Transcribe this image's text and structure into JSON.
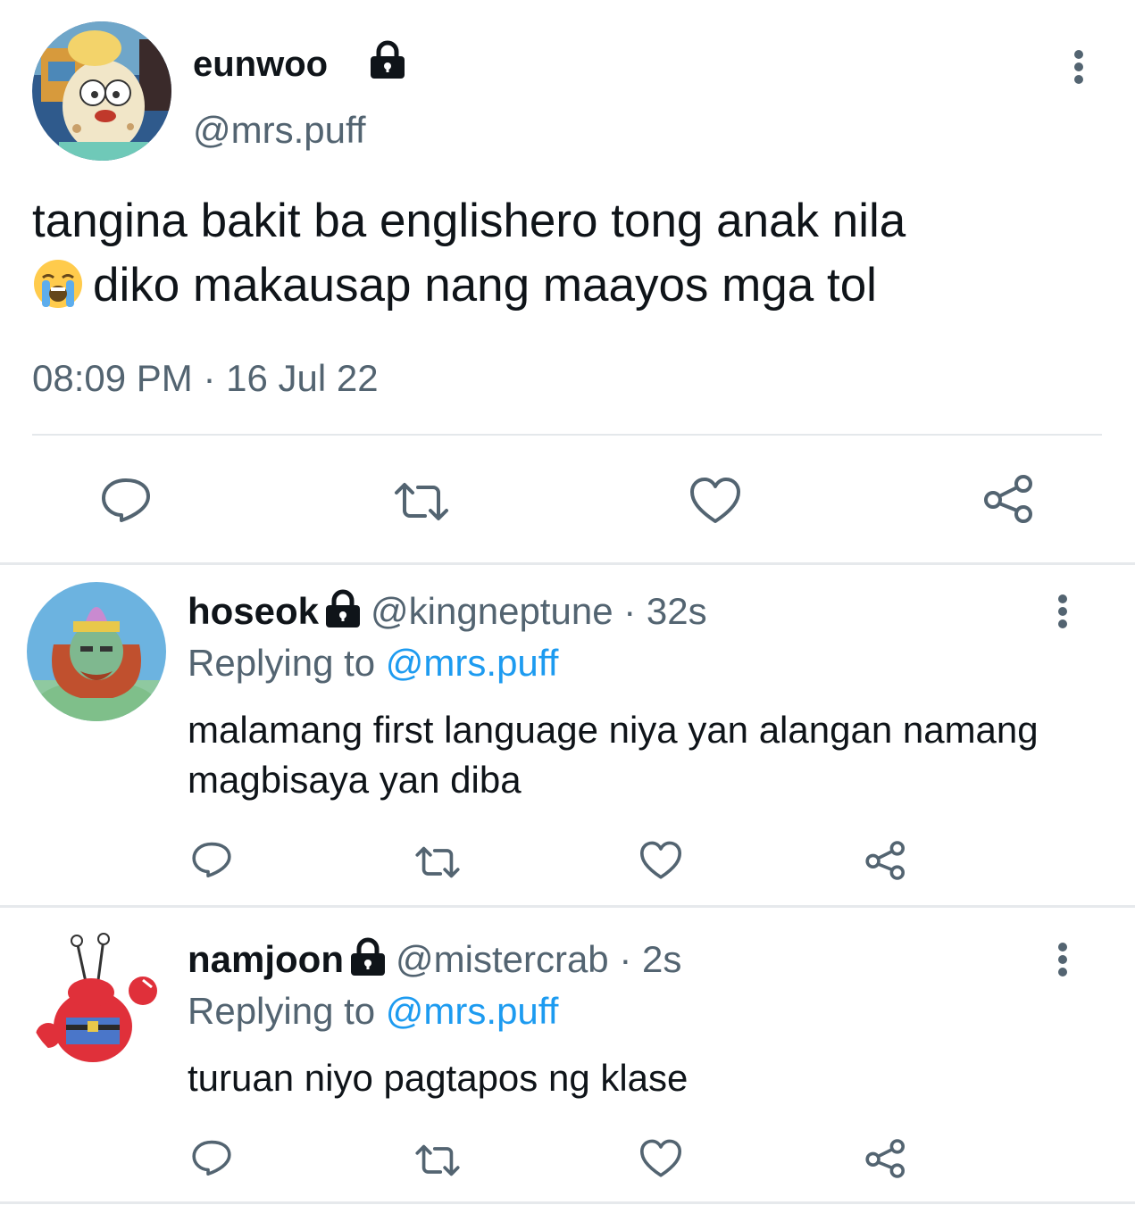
{
  "main_tweet": {
    "display_name": "eunwoo",
    "handle": "@mrs.puff",
    "text_line1": "tangina bakit ba englishero tong anak nila",
    "text_line2": "diko makausap nang maayos mga tol",
    "emoji": "loudly-crying-face",
    "timestamp": "08:09 PM · 16 Jul 22"
  },
  "replies": [
    {
      "display_name": "hoseok",
      "handle": "@kingneptune",
      "time": "· 32s",
      "replying_prefix": "Replying to",
      "replying_to": "@mrs.puff",
      "text": "malamang first language niya yan alangan namang magbisaya yan diba"
    },
    {
      "display_name": "namjoon",
      "handle": "@mistercrab",
      "time": "· 2s",
      "replying_prefix": "Replying to",
      "replying_to": "@mrs.puff",
      "text": "turuan niyo pagtapos ng klase"
    }
  ],
  "icons": {
    "reply": "reply-icon",
    "retweet": "retweet-icon",
    "like": "heart-icon",
    "share": "share-icon",
    "more": "more-vertical-icon",
    "lock": "lock-icon"
  },
  "colors": {
    "text": "#0f1419",
    "secondary": "#536471",
    "link": "#1d9bf0",
    "divider": "#e6e9ec"
  }
}
